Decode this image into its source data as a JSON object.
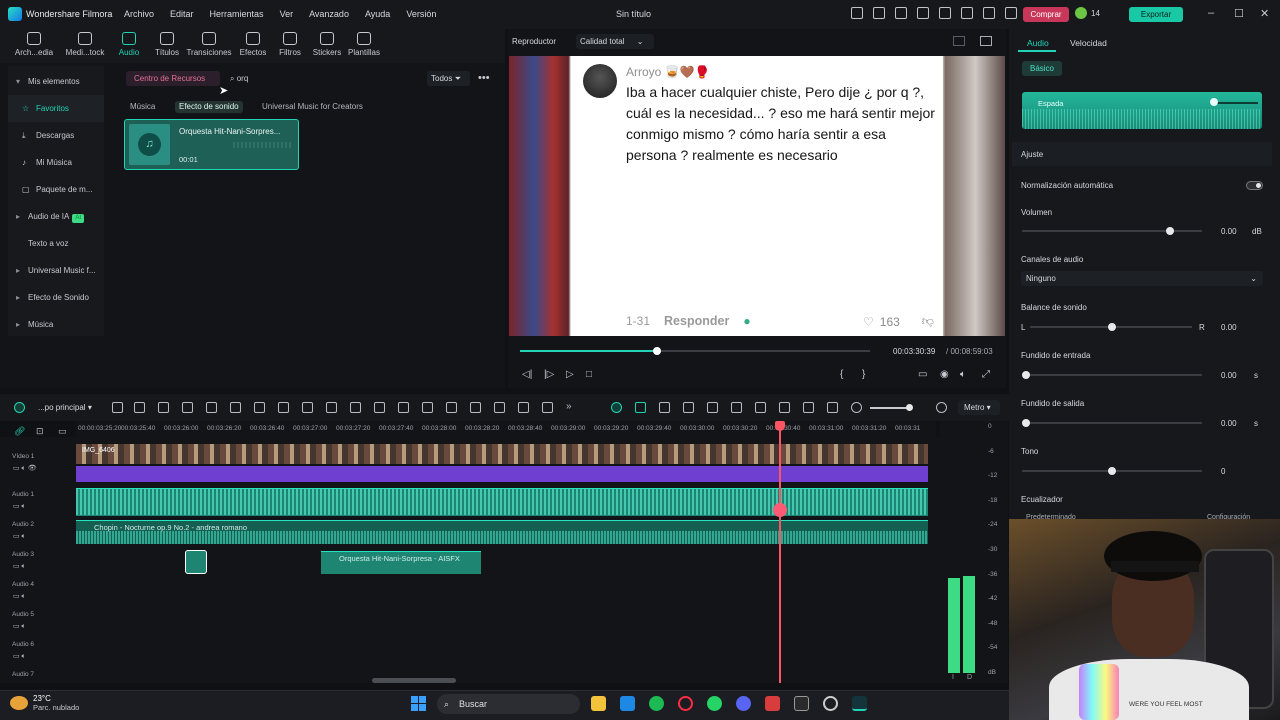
{
  "titlebar": {
    "app_name": "Wondershare Filmora",
    "menu": [
      "Archivo",
      "Editar",
      "Herramientas",
      "Ver",
      "Avanzado",
      "Ayuda",
      "Versión"
    ],
    "doc_title": "Sin título",
    "buy_label": "Comprar",
    "credits": "14",
    "export_label": "Exportar",
    "minimize": "–",
    "maximize": "☐",
    "close": "✕"
  },
  "media_toolbar": {
    "tools": [
      "Arch...edia",
      "Medi...tock",
      "Audio",
      "Títulos",
      "Transiciones",
      "Efectos",
      "Filtros",
      "Stickers",
      "Plantillas"
    ],
    "active": "Audio"
  },
  "library": {
    "nav": {
      "my_elements": "Mis elementos",
      "favorites": "Favoritos",
      "downloads": "Descargas",
      "my_music": "Mi Música",
      "package": "Paquete de m...",
      "ai_audio": "Audio de IA",
      "ai_badge": "AI",
      "tts": "Texto a voz",
      "universal": "Universal Music f...",
      "sfx": "Efecto de Sonido",
      "music": "Música"
    },
    "resource_center": "Centro de Recursos",
    "search_value": "orq",
    "filter_label": "Todos",
    "subtabs": [
      "Música",
      "Efecto de sonido",
      "Universal Music for Creators"
    ],
    "selected_subtab": "Efecto de sonido",
    "card": {
      "title": "Orquesta Hit-Nani-Sorpres...",
      "duration": "00:01"
    }
  },
  "player": {
    "label": "Reproductor",
    "quality": "Calidad total",
    "current_time": "00:03:30:39",
    "total_time": "/ 00:08:59:03",
    "progress_fraction": 0.39,
    "comment": {
      "user": "Arroyo 🥃🤎🥊",
      "text": "Iba a hacer cualquier chiste, Pero dije ¿ por q ?, cuál es la necesidad... ? eso me hará sentir mejor conmigo mismo ? cómo haría sentir a esa persona ? realmente es necesario",
      "date": "1-31",
      "reply": "Responder",
      "likes": "163"
    }
  },
  "right_panel": {
    "tabs": [
      "Audio",
      "Velocidad"
    ],
    "basic": "Básico",
    "preset": "Espada",
    "section": "Ajuste",
    "auto_norm": "Normalización automática",
    "volume_label": "Volumen",
    "volume_value": "0.00",
    "volume_unit": "dB",
    "channels_label": "Canales de audio",
    "channels_value": "Ninguno",
    "balance_label": "Balance de sonido",
    "balance_l": "L",
    "balance_r": "R",
    "balance_value": "0.00",
    "fade_in_label": "Fundido de entrada",
    "fade_in_value": "0.00",
    "fade_out_label": "Fundido  de salida",
    "fade_out_value": "0.00",
    "sec_unit": "s",
    "pitch_label": "Tono",
    "pitch_value": "0",
    "eq_label": "Ecualizador",
    "eq_value": "Predeterminado",
    "eq_config": "Configuración"
  },
  "timeline": {
    "project": "...po principal",
    "metro": "Metro",
    "ruler": [
      "00:00:03:25:20",
      "00:03:25:40",
      "00:03:26:00",
      "00:03:26:20",
      "00:03:26:40",
      "00:03:27:00",
      "00:03:27:20",
      "00:03:27:40",
      "00:03:28:00",
      "00:03:28:20",
      "00:03:28:40",
      "00:03:29:00",
      "00:03:29:20",
      "00:03:29:40",
      "00:03:30:00",
      "00:03:30:20",
      "00:03:30:40",
      "00:03:31:00",
      "00:03:31:20",
      "00:03:31"
    ],
    "tracks": [
      "Vídeo 1",
      "Audio 1",
      "Audio 2",
      "Audio 3",
      "Audio 4",
      "Audio 5",
      "Audio 6",
      "Audio 7"
    ],
    "video_clip": "IMG_6406",
    "audio2_clip": "Chopin - Nocturne op.9 No.2 - andrea romano",
    "audio3_clip": "Orquesta Hit-Nani-Sorpresa - AISFX"
  },
  "meter": {
    "scale": [
      "0",
      "-6",
      "-12",
      "-18",
      "-24",
      "-30",
      "-36",
      "-42",
      "-48",
      "-54",
      "dB"
    ],
    "channels": [
      "I",
      "D"
    ]
  },
  "webcam": {
    "shirt_text": "WERE YOU FEEL MOST"
  },
  "taskbar": {
    "temp": "23°C",
    "weather": "Parc. nublado",
    "search": "Buscar"
  }
}
